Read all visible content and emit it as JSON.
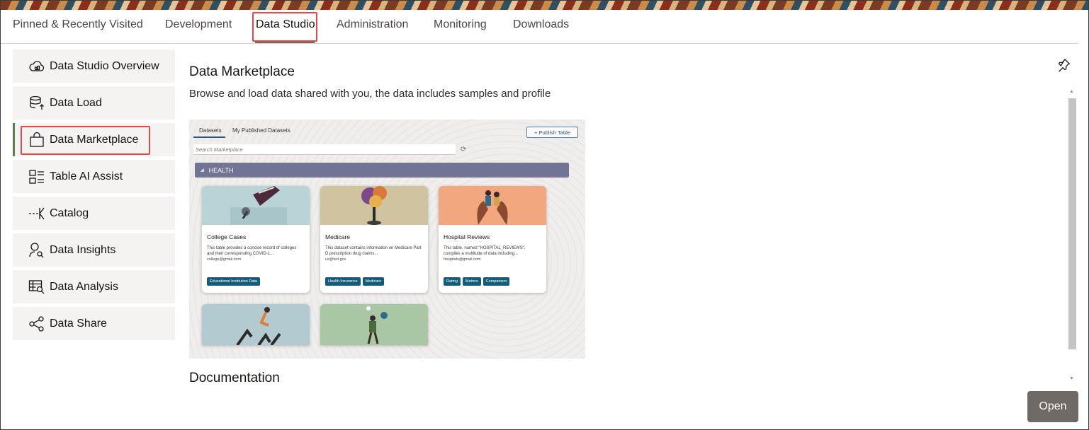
{
  "tabs": {
    "pinned": "Pinned & Recently Visited",
    "development": "Development",
    "data_studio": "Data Studio",
    "administration": "Administration",
    "monitoring": "Monitoring",
    "downloads": "Downloads",
    "active": "Data Studio"
  },
  "sidebar": {
    "items": [
      {
        "label": "Data Studio Overview",
        "icon": "cloud-icon"
      },
      {
        "label": "Data Load",
        "icon": "database-upload-icon"
      },
      {
        "label": "Data Marketplace",
        "icon": "shopping-bag-icon",
        "selected": true
      },
      {
        "label": "Table AI Assist",
        "icon": "table-ai-icon"
      },
      {
        "label": "Catalog",
        "icon": "catalog-icon"
      },
      {
        "label": "Data Insights",
        "icon": "person-search-icon"
      },
      {
        "label": "Data Analysis",
        "icon": "table-search-icon"
      },
      {
        "label": "Data Share",
        "icon": "share-icon"
      }
    ]
  },
  "main": {
    "title": "Data Marketplace",
    "description": "Browse and load data shared with you, the data includes samples and profile",
    "documentation_title": "Documentation",
    "open_label": "Open",
    "preview": {
      "tab_datasets": "Datasets",
      "tab_published": "My Published Datasets",
      "publish_label": "+ Publish Table",
      "search_placeholder": "Search Marketplace",
      "band_label": "HEALTH",
      "cards": [
        {
          "title": "College Cases",
          "desc": "This table provides a concise record of colleges and their corresponding COVID-1...",
          "email": "college@gmail.com",
          "tags": [
            "Educational Institution Data"
          ]
        },
        {
          "title": "Medicare",
          "desc": "This dataset contains information on Medicare Part D prescription drug claims...",
          "email": "us@fed.gov",
          "tags": [
            "Health Insurance",
            "Medicare"
          ]
        },
        {
          "title": "Hospital Reviews",
          "desc": "This table, named \"HOSPITAL_REVIEWS\", compiles a multitude of data including...",
          "email": "hospitals@gmail.com",
          "tags": [
            "Rating",
            "Metrics",
            "Comparison"
          ]
        }
      ]
    }
  },
  "colors": {
    "highlight": "#e04a4a",
    "band": "#727493",
    "tag": "#155c7a",
    "open_button": "#6f6a65"
  }
}
